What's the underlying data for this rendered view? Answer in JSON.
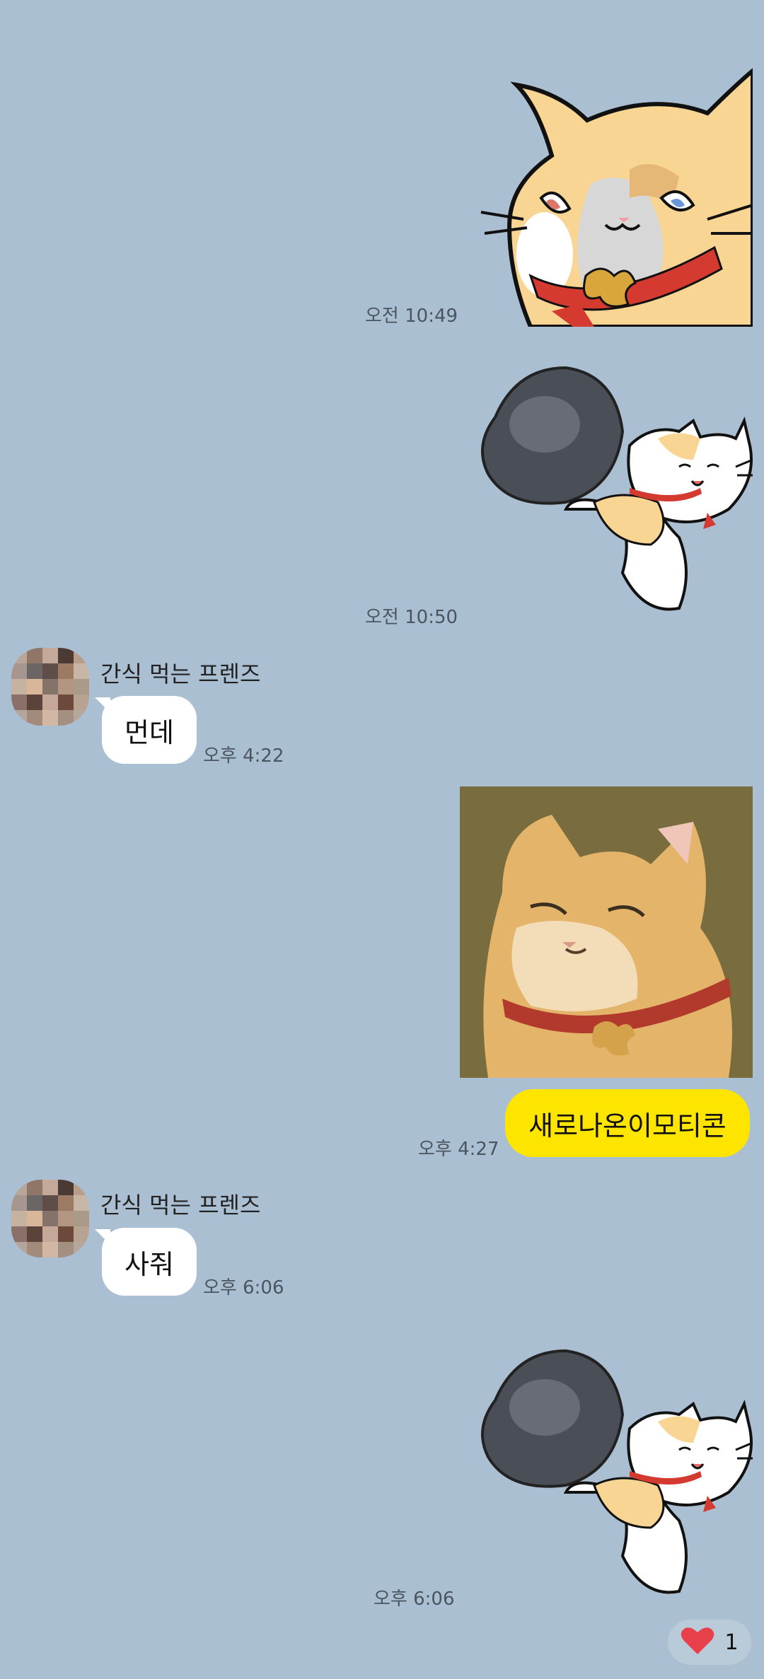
{
  "chat": {
    "messages": [
      {
        "type": "sticker",
        "direction": "out",
        "sticker": "cat-sly-face-sticker",
        "time": "오전 10:49"
      },
      {
        "type": "sticker",
        "direction": "out",
        "sticker": "cat-with-rock-sticker",
        "time": "오전 10:50"
      },
      {
        "type": "text",
        "direction": "in",
        "sender": "간식 먹는 프렌즈",
        "text": "먼데",
        "time": "오후 4:22"
      },
      {
        "type": "image-text",
        "direction": "out",
        "image": "cat-portrait-painting",
        "text": "새로나온이모티콘",
        "time": "오후 4:27"
      },
      {
        "type": "text",
        "direction": "in",
        "sender": "간식 먹는 프렌즈",
        "text": "사줘",
        "time": "오후 6:06"
      },
      {
        "type": "sticker",
        "direction": "out",
        "sticker": "cat-with-rock-sticker",
        "time": "오후 6:06"
      }
    ],
    "reaction": {
      "icon": "heart-icon",
      "count": "1"
    }
  },
  "colors": {
    "background": "#abbfd2",
    "outgoing_bubble": "#fee500",
    "incoming_bubble": "#ffffff",
    "heart": "#e8404a"
  }
}
